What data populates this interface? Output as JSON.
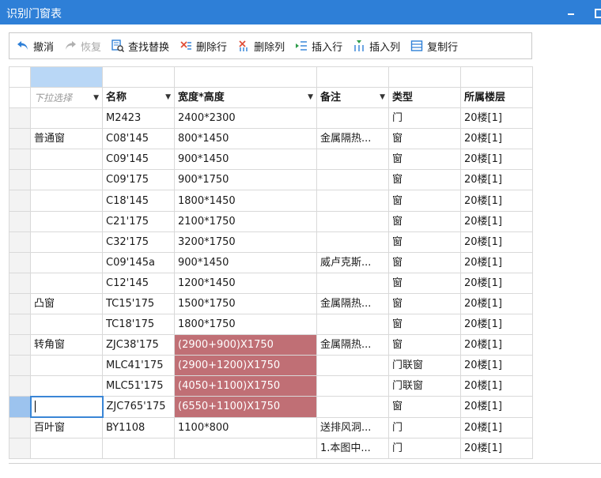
{
  "window": {
    "title": "识别门窗表"
  },
  "toolbar": {
    "undo": "撤消",
    "redo": "恢复",
    "find_replace": "查找替换",
    "delete_row": "删除行",
    "delete_col": "删除列",
    "insert_row": "插入行",
    "insert_col": "插入列",
    "copy_row": "复制行"
  },
  "colors": {
    "titlebar": "#2e7fd7",
    "highlight": "#c06f75",
    "selected": "#b9d7f6"
  },
  "table": {
    "headers": [
      "下拉选择",
      "名称",
      "宽度*高度",
      "备注",
      "类型",
      "所属楼层"
    ],
    "rows": [
      [
        "",
        "M2423",
        "2400*2300",
        "",
        "门",
        "20楼[1]"
      ],
      [
        "普通窗",
        "C08'145",
        "800*1450",
        "金属隔热...",
        "窗",
        "20楼[1]"
      ],
      [
        "",
        "C09'145",
        "900*1450",
        "",
        "窗",
        "20楼[1]"
      ],
      [
        "",
        "C09'175",
        "900*1750",
        "",
        "窗",
        "20楼[1]"
      ],
      [
        "",
        "C18'145",
        "1800*1450",
        "",
        "窗",
        "20楼[1]"
      ],
      [
        "",
        "C21'175",
        "2100*1750",
        "",
        "窗",
        "20楼[1]"
      ],
      [
        "",
        "C32'175",
        "3200*1750",
        "",
        "窗",
        "20楼[1]"
      ],
      [
        "",
        "C09'145a",
        "900*1450",
        "威卢克斯...",
        "窗",
        "20楼[1]"
      ],
      [
        "",
        "C12'145",
        "1200*1450",
        "",
        "窗",
        "20楼[1]"
      ],
      [
        "凸窗",
        "TC15'175",
        "1500*1750",
        "金属隔热...",
        "窗",
        "20楼[1]"
      ],
      [
        "",
        "TC18'175",
        "1800*1750",
        "",
        "窗",
        "20楼[1]"
      ],
      [
        "转角窗",
        "ZJC38'175",
        "(2900+900)X1750",
        "金属隔热...",
        "窗",
        "20楼[1]"
      ],
      [
        "",
        "MLC41'175",
        "(2900+1200)X1750",
        "",
        "门联窗",
        "20楼[1]"
      ],
      [
        "",
        "MLC51'175",
        "(4050+1100)X1750",
        "",
        "门联窗",
        "20楼[1]"
      ],
      [
        "",
        "ZJC765'175",
        "(6550+1100)X1750",
        "",
        "窗",
        "20楼[1]"
      ],
      [
        "百叶窗",
        "BY1108",
        "1100*800",
        "送排风洞...",
        "门",
        "20楼[1]"
      ],
      [
        "",
        "",
        "",
        "1.本图中...",
        "门",
        "20楼[1]"
      ]
    ]
  }
}
